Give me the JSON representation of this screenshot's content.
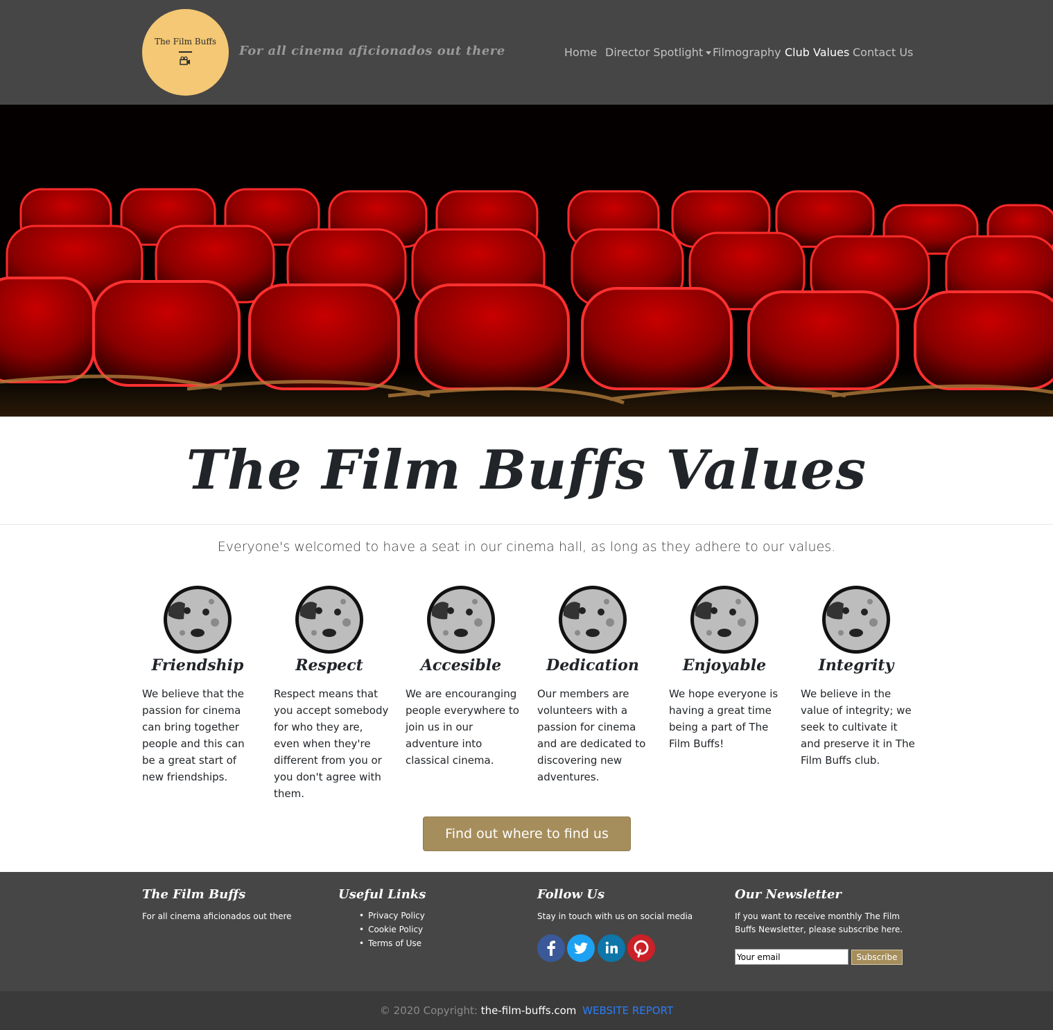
{
  "brand": {
    "logo_text": "The Film Buffs",
    "tagline": "For all cinema aficionados out there"
  },
  "nav": [
    {
      "label": "Home",
      "active": false
    },
    {
      "label": "Director Spotlight",
      "active": false,
      "dropdown": true
    },
    {
      "label": "Filmography",
      "active": false
    },
    {
      "label": "Club Values",
      "active": true
    },
    {
      "label": "Contact Us",
      "active": false
    }
  ],
  "hero": {
    "image": "red cinema seats"
  },
  "main": {
    "title": "The Film Buffs Values",
    "lead": "Everyone's welcomed to have a seat in our cinema hall, as long as they adhere to our values."
  },
  "values": [
    {
      "title": "Friendship",
      "text": "We believe that the passion for cinema can bring together people and this can be a great start of new friendships.",
      "icon": "moon-face-icon"
    },
    {
      "title": "Respect",
      "text": "Respect means that you accept somebody for who they are, even when they're different from you or you don't agree with them.",
      "icon": "moon-face-icon"
    },
    {
      "title": "Accesible",
      "text": "We are encouranging people everywhere to join us in our adventure into classical cinema.",
      "icon": "moon-face-icon"
    },
    {
      "title": "Dedication",
      "text": "Our members are volunteers with a passion for cinema and are dedicated to discovering new adventures.",
      "icon": "moon-face-icon"
    },
    {
      "title": "Enjoyable",
      "text": "We hope everyone is having a great time being a part of The Film Buffs!",
      "icon": "moon-face-icon"
    },
    {
      "title": "Integrity",
      "text": "We believe in the value of integrity; we seek to cultivate it and preserve it in The Film Buffs club.",
      "icon": "moon-face-icon"
    }
  ],
  "cta": {
    "label": "Find out where to find us"
  },
  "footer": {
    "brand_title": "The Film Buffs",
    "brand_text": "For all cinema aficionados out there",
    "links_title": "Useful Links",
    "links": [
      "Privacy Policy",
      "Cookie Policy",
      "Terms of Use"
    ],
    "follow_title": "Follow Us",
    "follow_text": "Stay in touch with us on social media",
    "socials": [
      {
        "name": "facebook-icon",
        "color": "#3b5998"
      },
      {
        "name": "twitter-icon",
        "color": "#1da1f2"
      },
      {
        "name": "linkedin-icon",
        "color": "#0e76a8"
      },
      {
        "name": "pinterest-icon",
        "color": "#cb2027"
      }
    ],
    "newsletter_title": "Our Newsletter",
    "newsletter_text": "If you want to receive monthly The Film Buffs Newsletter, please subscribe here.",
    "email_value": "Your email",
    "subscribe_label": "Subscribe"
  },
  "copyright": {
    "prefix": "© 2020 Copyright:",
    "site": "the-film-buffs.com",
    "report": "WEBSITE REPORT"
  },
  "colors": {
    "nav_bg": "#464646",
    "logo_bg": "#f4c874",
    "accent_button": "#a68e5c",
    "link_blue": "#2a7df7"
  }
}
